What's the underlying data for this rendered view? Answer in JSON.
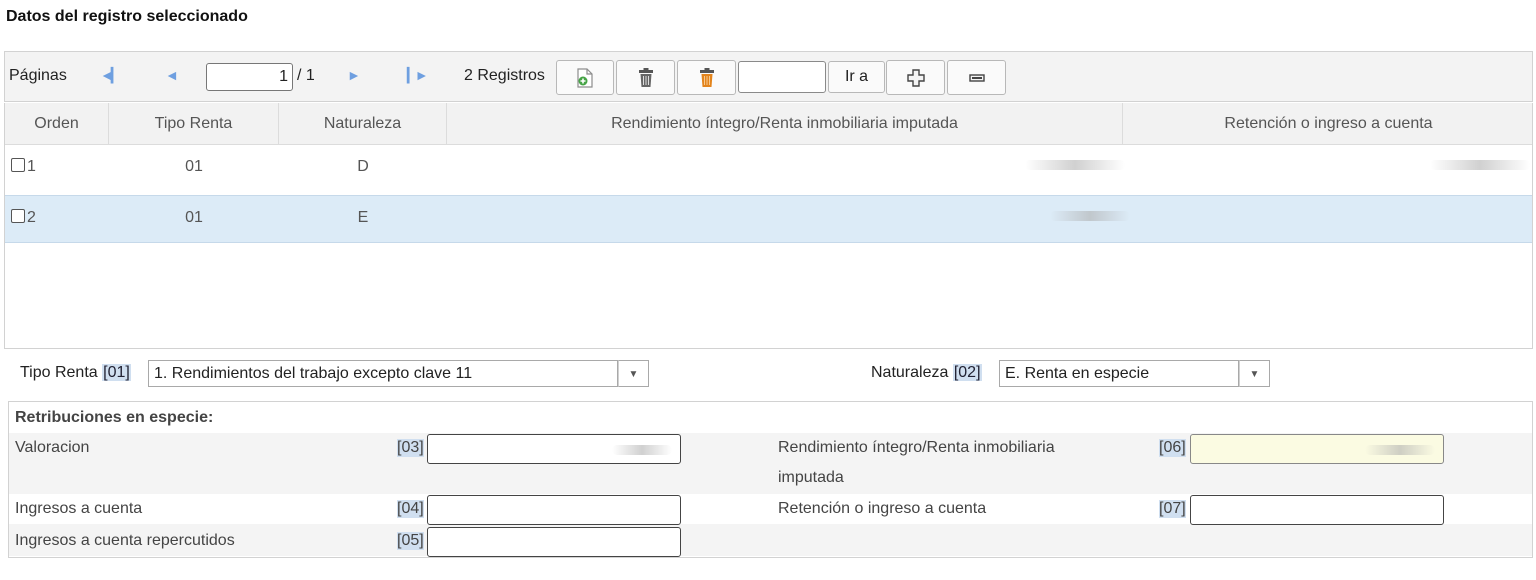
{
  "section_title": "Datos del registro seleccionado",
  "toolbar": {
    "pages_label": "Páginas",
    "page_value": "1",
    "page_total": "/ 1",
    "records_label": "2 Registros",
    "goto_value": "",
    "goto_label": "Ir a"
  },
  "grid": {
    "headers": [
      "Orden",
      "Tipo Renta",
      "Naturaleza",
      "Rendimiento íntegro/Renta inmobiliaria imputada",
      "Retención o ingreso a cuenta"
    ],
    "rows": [
      {
        "orden": "1",
        "tipo_renta": "01",
        "naturaleza": "D",
        "selected": false
      },
      {
        "orden": "2",
        "tipo_renta": "01",
        "naturaleza": "E",
        "selected": true
      }
    ]
  },
  "form": {
    "tipo_renta_label": "Tipo Renta",
    "tipo_renta_code": "[01]",
    "tipo_renta_value": "1. Rendimientos del trabajo excepto clave 11",
    "naturaleza_label": "Naturaleza",
    "naturaleza_code": "[02]",
    "naturaleza_value": "E. Renta en especie"
  },
  "panel": {
    "title": "Retribuciones en especie:",
    "fields": {
      "valoracion": {
        "label": "Valoracion",
        "code": "[03]"
      },
      "ingresos": {
        "label": "Ingresos a cuenta",
        "code": "[04]"
      },
      "repercutidos": {
        "label": "Ingresos a cuenta repercutidos",
        "code": "[05]"
      },
      "rendimiento": {
        "label_line1": "Rendimiento íntegro/Renta inmobiliaria",
        "label_line2": "imputada",
        "code": "[06]"
      },
      "retencion": {
        "label": "Retención o ingreso a cuenta",
        "code": "[07]"
      }
    }
  },
  "icons": {
    "first": "first-page-icon",
    "prev": "previous-page-icon",
    "next": "next-page-icon",
    "last": "last-page-icon",
    "add": "add-record-icon",
    "delete": "trash-icon",
    "delete_all": "trash-orange-icon",
    "expand": "expand-icon",
    "collapse": "collapse-icon",
    "dropdown": "chevron-down-icon"
  },
  "colors": {
    "selected_row": "#dcebf7",
    "code_badge": "#d0dff0",
    "readonly_field": "#fbfbe2",
    "nav_arrow": "#6e9fe0"
  }
}
